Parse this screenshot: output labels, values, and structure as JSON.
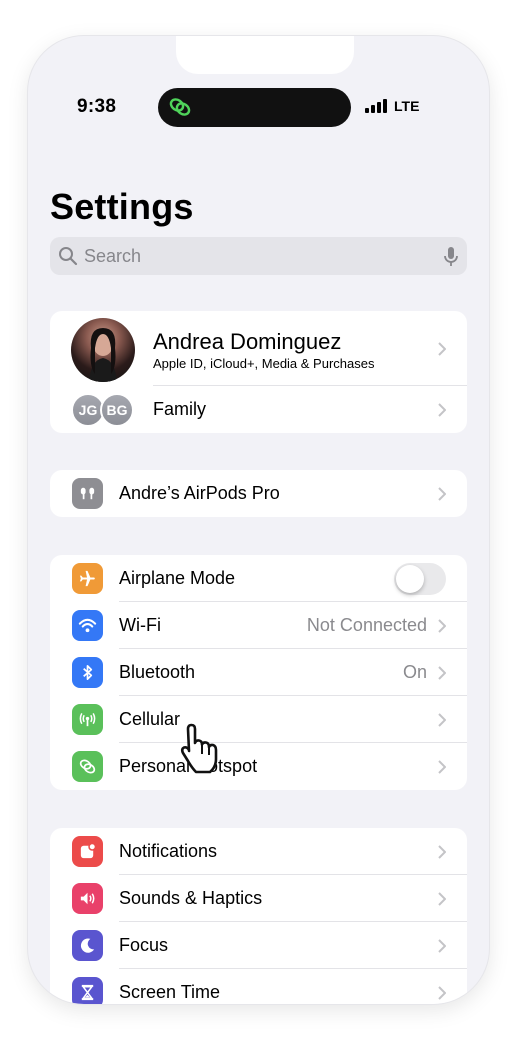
{
  "status_bar": {
    "time": "9:38",
    "network": "LTE"
  },
  "page": {
    "title": "Settings"
  },
  "search": {
    "placeholder": "Search"
  },
  "profile": {
    "name": "Andrea Dominguez",
    "subtitle": "Apple ID, iCloud+, Media & Purchases",
    "family_label": "Family",
    "family_badges": [
      "JG",
      "BG"
    ]
  },
  "airpods": {
    "label": "Andre’s AirPods Pro"
  },
  "connectivity": {
    "items": [
      {
        "label": "Airplane Mode",
        "icon": "airplane-icon",
        "color": "#f09a37",
        "toggle": false
      },
      {
        "label": "Wi-Fi",
        "icon": "wifi-icon",
        "color": "#3478f6",
        "value": "Not Connected"
      },
      {
        "label": "Bluetooth",
        "icon": "bluetooth-icon",
        "color": "#3478f6",
        "value": "On"
      },
      {
        "label": "Cellular",
        "icon": "cellular-icon",
        "color": "#5ac05a"
      },
      {
        "label": "Personal Hotspot",
        "icon": "hotspot-icon",
        "color": "#5ac05a"
      }
    ]
  },
  "notifications_group": {
    "items": [
      {
        "label": "Notifications",
        "icon": "notifications-icon",
        "color": "#ec4b4a"
      },
      {
        "label": "Sounds & Haptics",
        "icon": "sounds-icon",
        "color": "#e9416a"
      },
      {
        "label": "Focus",
        "icon": "focus-icon",
        "color": "#5a55cf"
      },
      {
        "label": "Screen Time",
        "icon": "hourglass-icon",
        "color": "#5a55cf"
      }
    ]
  }
}
